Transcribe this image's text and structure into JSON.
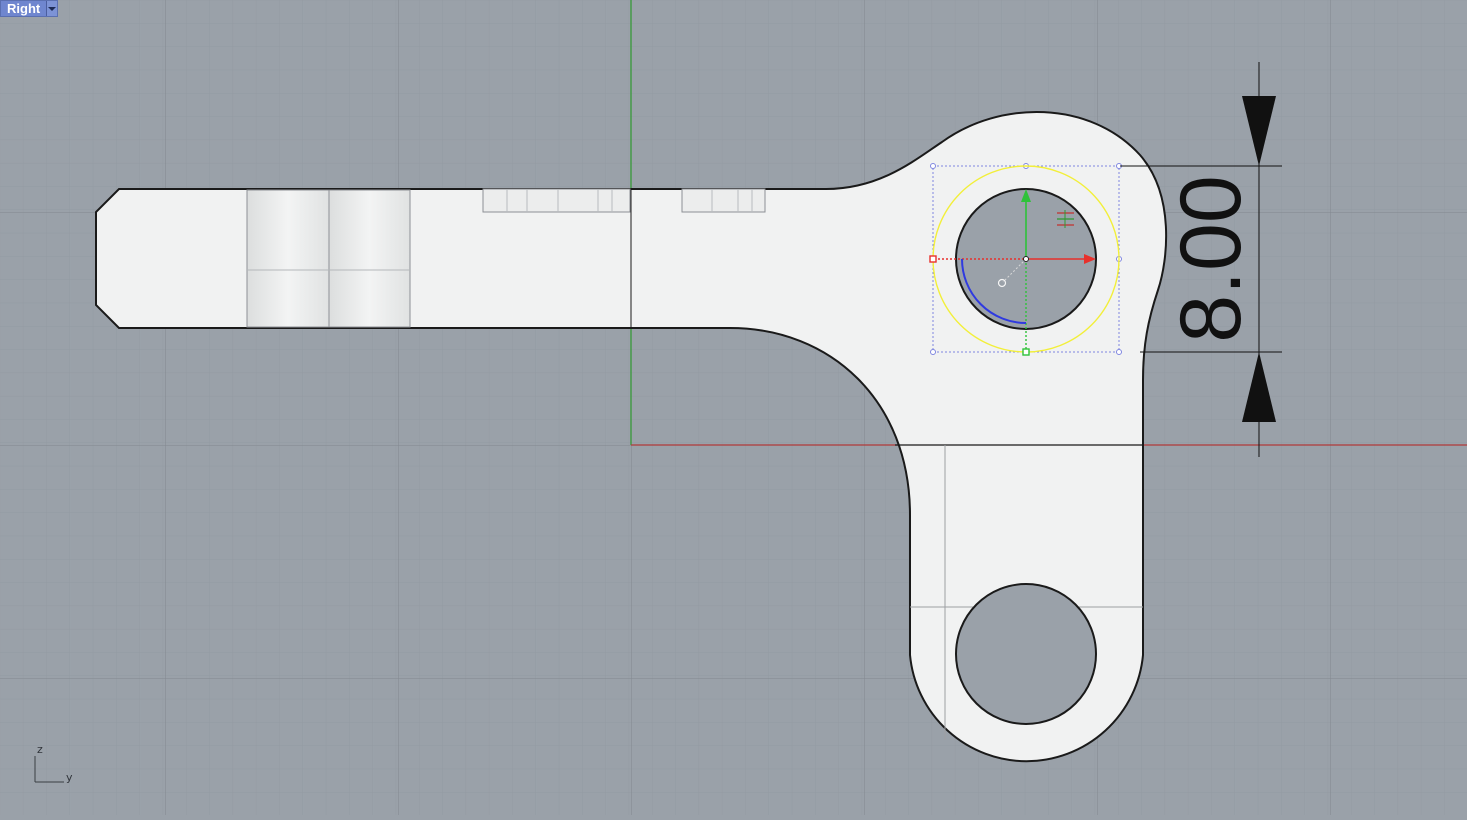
{
  "viewport": {
    "name": "Right",
    "menu_icon": "chevron-down-icon"
  },
  "dimension": {
    "value_text": "8.00"
  },
  "axis_indicator": {
    "vertical_label": "z",
    "horizontal_label": "y"
  },
  "colors": {
    "background": "#9aa1a9",
    "grid_minor": "#939aa2",
    "grid_major": "#878d94",
    "axis_x": "#b03a3a",
    "axis_z": "#2f9a2f",
    "part_fill": "#f1f2f2",
    "part_edge": "#1a1a1a",
    "selection_circle": "#f2ef3a",
    "gumball_x": "#e8302c",
    "gumball_y": "#2fc23a",
    "gumball_arc": "#2f3ae0",
    "viewport_tab": "#6f86cf"
  }
}
